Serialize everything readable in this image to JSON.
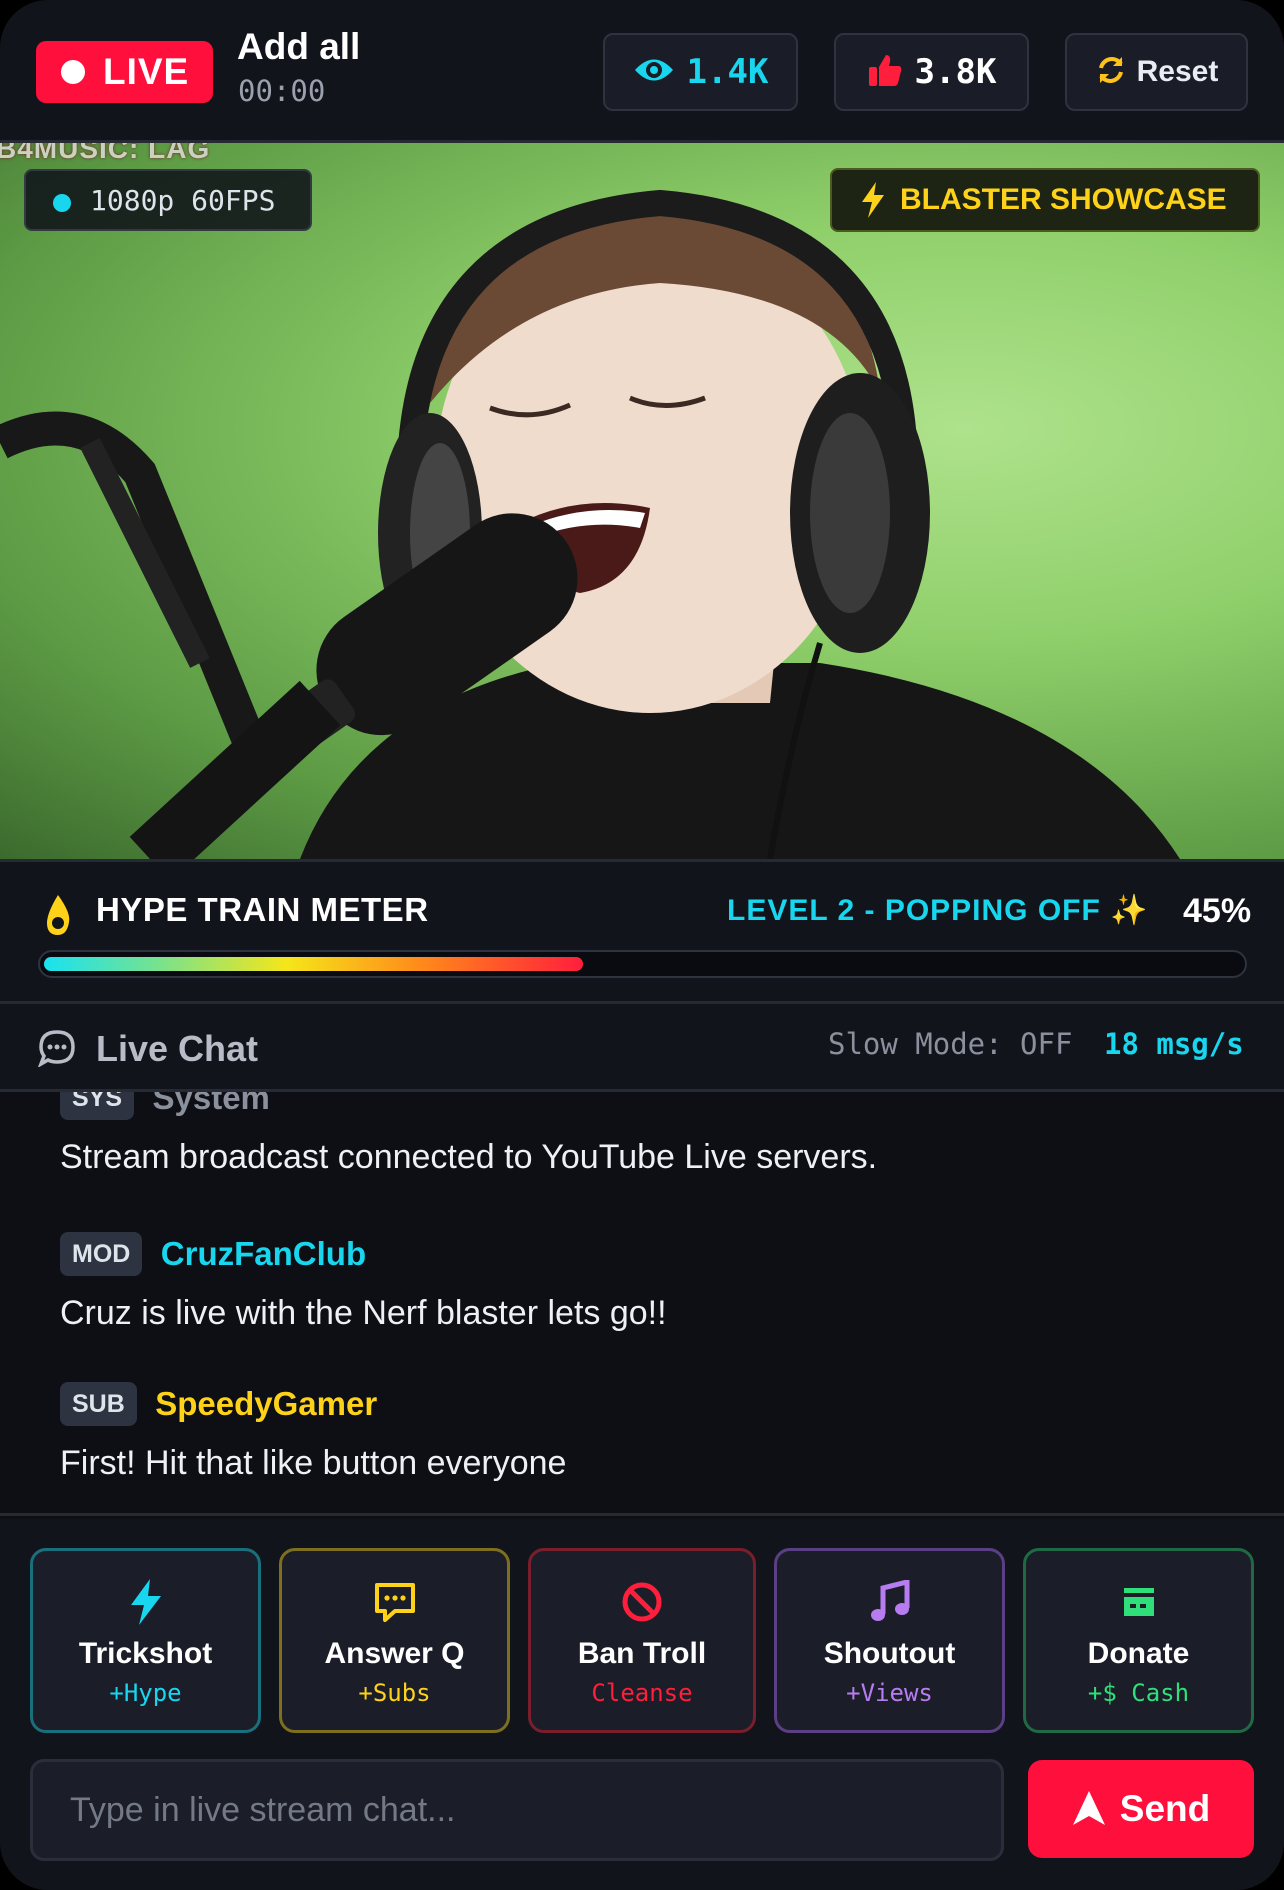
{
  "header": {
    "live_label": "LIVE",
    "title": "Add all",
    "timer": "00:00",
    "views": "1.4K",
    "likes": "3.8K",
    "reset_label": "Reset"
  },
  "video": {
    "overlay_text": "B4MUSIC: LAG",
    "quality": "1080p 60FPS",
    "showcase_label": "BLASTER SHOWCASE"
  },
  "hype": {
    "title": "HYPE TRAIN METER",
    "level": "LEVEL 2 - POPPING OFF ✨",
    "percent_label": "45%",
    "progress_fraction": 0.45
  },
  "chat": {
    "title": "Live Chat",
    "slow_mode": "Slow Mode: OFF",
    "rate": "18 msg/s",
    "messages": [
      {
        "badge": "SYS",
        "user": "System",
        "text": "Stream broadcast connected to YouTube Live servers.",
        "color": "#8a909c"
      },
      {
        "badge": "MOD",
        "user": "CruzFanClub",
        "text": "Cruz is live with the Nerf blaster lets go!!",
        "color": "#19d6ef"
      },
      {
        "badge": "SUB",
        "user": "SpeedyGamer",
        "text": "First! Hit that like button everyone",
        "color": "#ffd21a"
      }
    ]
  },
  "actions": [
    {
      "label": "Trickshot",
      "sub": "+Hype",
      "icon": "lightning-icon",
      "color": "#19d6ef",
      "border": "#1a6f7c"
    },
    {
      "label": "Answer Q",
      "sub": "+Subs",
      "icon": "chat-bubble-icon",
      "color": "#ffd21a",
      "border": "#7d6f1e"
    },
    {
      "label": "Ban Troll",
      "sub": "Cleanse",
      "icon": "ban-icon",
      "color": "#ff1e3c",
      "border": "#7a1e2c"
    },
    {
      "label": "Shoutout",
      "sub": "+Views",
      "icon": "music-note-icon",
      "color": "#b77cf0",
      "border": "#5b3f85"
    },
    {
      "label": "Donate",
      "sub": "+$ Cash",
      "icon": "cash-register-icon",
      "color": "#2fe07a",
      "border": "#1f6a44"
    }
  ],
  "composer": {
    "placeholder": "Type in live stream chat...",
    "send_label": "Send"
  },
  "colors": {
    "live_red": "#ff0f3c",
    "accent_cyan": "#19d6ef",
    "accent_yellow": "#ffd21a",
    "background": "#0e0f14"
  }
}
